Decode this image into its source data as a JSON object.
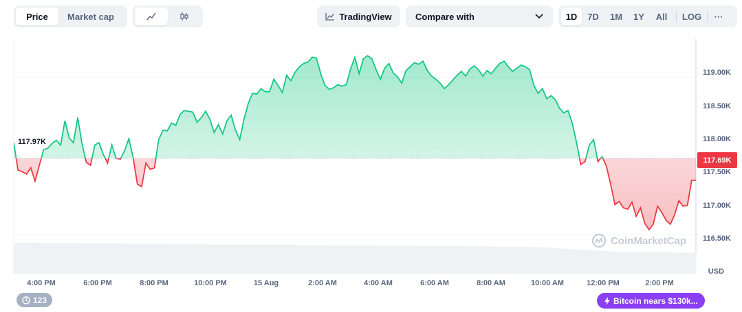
{
  "toolbar": {
    "metric_tabs": [
      "Price",
      "Market cap"
    ],
    "tradingview_label": "TradingView",
    "compare_label": "Compare with",
    "ranges": [
      "1D",
      "7D",
      "1M",
      "1Y",
      "All",
      "LOG"
    ],
    "more_label": "···"
  },
  "chart_data": {
    "type": "area",
    "currency_label": "USD",
    "reference_label": "117.97K",
    "reference_value": 117.97,
    "current_label": "117.69K",
    "y_ticks": [
      "119.00K",
      "118.50K",
      "118.00K",
      "117.50K",
      "117.00K",
      "116.50K"
    ],
    "y_tick_values": [
      119.0,
      118.5,
      118.0,
      117.5,
      117.0,
      116.5
    ],
    "ylim": [
      116.5,
      119.5
    ],
    "x_ticks": [
      "4:00 PM",
      "6:00 PM",
      "8:00 PM",
      "10:00 PM",
      "15 Aug",
      "2:00 AM",
      "4:00 AM",
      "6:00 AM",
      "8:00 AM",
      "10:00 AM",
      "12:00 PM",
      "2:00 PM"
    ],
    "x_tick_hours": [
      1,
      3,
      5,
      7,
      9,
      11,
      13,
      15,
      17,
      19,
      21,
      23
    ],
    "xlim": [
      0,
      24
    ],
    "grid": true,
    "colors": {
      "up": "#16c784",
      "down": "#ea3943"
    },
    "series": [
      {
        "x": [
          0,
          0.15,
          0.3,
          0.45,
          0.6,
          0.75,
          0.9,
          1.05,
          1.2,
          1.35,
          1.5,
          1.65,
          1.8,
          1.95,
          2.1,
          2.25,
          2.4,
          2.55,
          2.7,
          2.85,
          3.0,
          3.15,
          3.3,
          3.45,
          3.6,
          3.75,
          3.9,
          4.05,
          4.2,
          4.35,
          4.5,
          4.65,
          4.8,
          4.95,
          5.1,
          5.25,
          5.4,
          5.55,
          5.7,
          5.85,
          6.0,
          6.15,
          6.3,
          6.45,
          6.6,
          6.75,
          6.9,
          7.05,
          7.2,
          7.35,
          7.5,
          7.65,
          7.8,
          7.95,
          8.1,
          8.25,
          8.4,
          8.55,
          8.7,
          8.85,
          9.0,
          9.15,
          9.3,
          9.45,
          9.6,
          9.75,
          9.9,
          10.05,
          10.2,
          10.35,
          10.5,
          10.65,
          10.8,
          10.95,
          11.1,
          11.25,
          11.4,
          11.55,
          11.7,
          11.85,
          12.0,
          12.15,
          12.3,
          12.45,
          12.6,
          12.75,
          12.9,
          13.05,
          13.2,
          13.35,
          13.5,
          13.65,
          13.8,
          13.95,
          14.1,
          14.25,
          14.4,
          14.55,
          14.7,
          14.85,
          15.0,
          15.15,
          15.3,
          15.45,
          15.6,
          15.75,
          15.9,
          16.05,
          16.2,
          16.35,
          16.5,
          16.65,
          16.8,
          16.95,
          17.1,
          17.25,
          17.4,
          17.55,
          17.7,
          17.85,
          18.0,
          18.15,
          18.3,
          18.45,
          18.6,
          18.75,
          18.9,
          19.05,
          19.2,
          19.35,
          19.5,
          19.65,
          19.8,
          19.95,
          20.1,
          20.25,
          20.4,
          20.55,
          20.7,
          20.85,
          21.0,
          21.15,
          21.3,
          21.45,
          21.6,
          21.75,
          21.9,
          22.05,
          22.2,
          22.35,
          22.5,
          22.65,
          22.8,
          22.95,
          23.1,
          23.25,
          23.4,
          23.55,
          23.7,
          23.85,
          24.0
        ],
        "values": [
          118.17,
          117.82,
          117.8,
          117.77,
          117.85,
          117.68,
          117.88,
          118.08,
          118.1,
          118.16,
          118.2,
          118.14,
          118.45,
          118.23,
          118.17,
          118.49,
          118.16,
          117.92,
          117.88,
          118.14,
          118.17,
          118.02,
          117.91,
          118.14,
          117.97,
          117.96,
          118.07,
          118.22,
          117.98,
          117.64,
          117.61,
          117.91,
          117.83,
          117.85,
          118.21,
          118.33,
          118.32,
          118.42,
          118.39,
          118.53,
          118.58,
          118.57,
          118.56,
          118.43,
          118.49,
          118.57,
          118.47,
          118.3,
          118.4,
          118.28,
          118.45,
          118.52,
          118.33,
          118.21,
          118.47,
          118.67,
          118.8,
          118.79,
          118.86,
          118.82,
          118.82,
          118.98,
          118.9,
          118.81,
          119.03,
          118.96,
          119.07,
          119.14,
          119.18,
          119.2,
          119.26,
          119.25,
          119.05,
          118.9,
          118.85,
          118.87,
          118.91,
          118.89,
          118.91,
          119.11,
          119.26,
          119.05,
          119.24,
          119.28,
          119.24,
          119.1,
          118.98,
          119.12,
          119.18,
          119.06,
          119.01,
          118.93,
          119.09,
          119.14,
          119.19,
          119.17,
          119.21,
          119.09,
          119.02,
          118.98,
          118.93,
          118.86,
          118.91,
          118.97,
          119.03,
          119.08,
          119.02,
          119.11,
          119.15,
          119.1,
          119.02,
          119.09,
          119.05,
          119.12,
          119.18,
          119.21,
          119.14,
          119.08,
          119.12,
          119.16,
          119.14,
          119.1,
          118.9,
          118.8,
          118.86,
          118.73,
          118.77,
          118.72,
          118.61,
          118.55,
          118.58,
          118.42,
          118.17,
          117.89,
          117.93,
          118.14,
          118.21,
          117.93,
          117.99,
          117.87,
          117.64,
          117.38,
          117.42,
          117.34,
          117.32,
          117.41,
          117.23,
          117.34,
          117.14,
          117.06,
          117.13,
          117.36,
          117.28,
          117.18,
          117.13,
          117.25,
          117.43,
          117.36,
          117.37,
          117.69,
          117.69
        ]
      }
    ],
    "volume": [
      0.92,
      0.92,
      0.91,
      0.91,
      0.91,
      0.91,
      0.9,
      0.9,
      0.9,
      0.9,
      0.89,
      0.89,
      0.89,
      0.89,
      0.88,
      0.88,
      0.88,
      0.87,
      0.87,
      0.87,
      0.87,
      0.86,
      0.86,
      0.86,
      0.86,
      0.85,
      0.85,
      0.85,
      0.84,
      0.84,
      0.84,
      0.84,
      0.83,
      0.83,
      0.83,
      0.83,
      0.82,
      0.82,
      0.82,
      0.82,
      0.81,
      0.81,
      0.81,
      0.8,
      0.8,
      0.8,
      0.79,
      0.78,
      0.76,
      0.74,
      0.72,
      0.7,
      0.68,
      0.66,
      0.64,
      0.64,
      0.63,
      0.63,
      0.63,
      0.62,
      0.62
    ],
    "watermark": "CoinMarketCap"
  },
  "badges": {
    "event_count": "123",
    "news_text": "Bitcoin nears $130k..."
  }
}
